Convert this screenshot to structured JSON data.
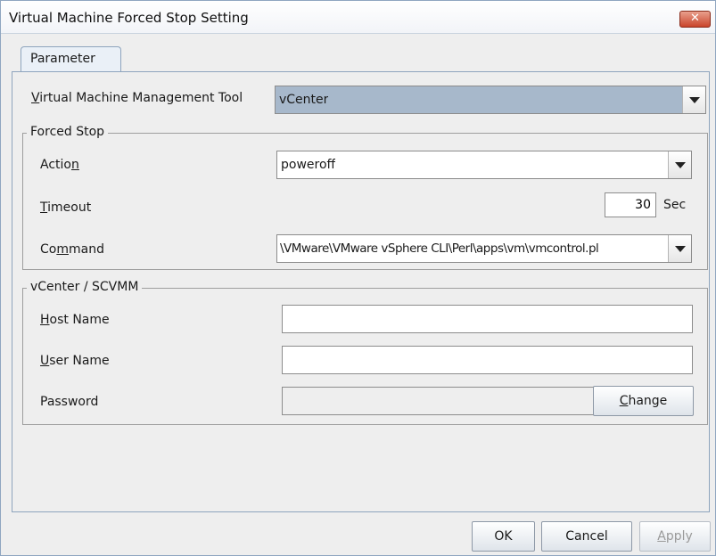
{
  "window": {
    "title": "Virtual Machine Forced Stop Setting",
    "close_symbol": "✕"
  },
  "tabs": [
    {
      "label": "Parameter"
    }
  ],
  "fields": {
    "management_tool": {
      "label_pre": "",
      "label_mn": "V",
      "label_post": "irtual Machine Management Tool",
      "value": "vCenter"
    },
    "forced_stop": {
      "title": "Forced Stop",
      "action": {
        "label_pre": "Actio",
        "label_mn": "n",
        "label_post": "",
        "value": "poweroff"
      },
      "timeout": {
        "label_pre": "",
        "label_mn": "T",
        "label_post": "imeout",
        "value": "30",
        "unit": "Sec"
      },
      "command": {
        "label_pre": "Co",
        "label_mn": "m",
        "label_post": "mand",
        "value": "\\VMware\\VMware vSphere CLI\\Perl\\apps\\vm\\vmcontrol.pl"
      }
    },
    "vcenter": {
      "title": "vCenter / SCVMM",
      "host_name": {
        "label_pre": "",
        "label_mn": "H",
        "label_post": "ost Name",
        "value": ""
      },
      "user_name": {
        "label_pre": "",
        "label_mn": "U",
        "label_post": "ser Name",
        "value": ""
      },
      "password": {
        "label": "Password",
        "value": "",
        "change_pre": "",
        "change_mn": "C",
        "change_post": "hange"
      }
    }
  },
  "buttons": {
    "ok": "OK",
    "cancel": "Cancel",
    "apply_pre": "",
    "apply_mn": "A",
    "apply_post": "pply"
  },
  "colors": {
    "title_bar": "#ffffff",
    "close": "#c9452b",
    "selected_combo": "#a7b8cb",
    "panel": "#eeeeee"
  }
}
